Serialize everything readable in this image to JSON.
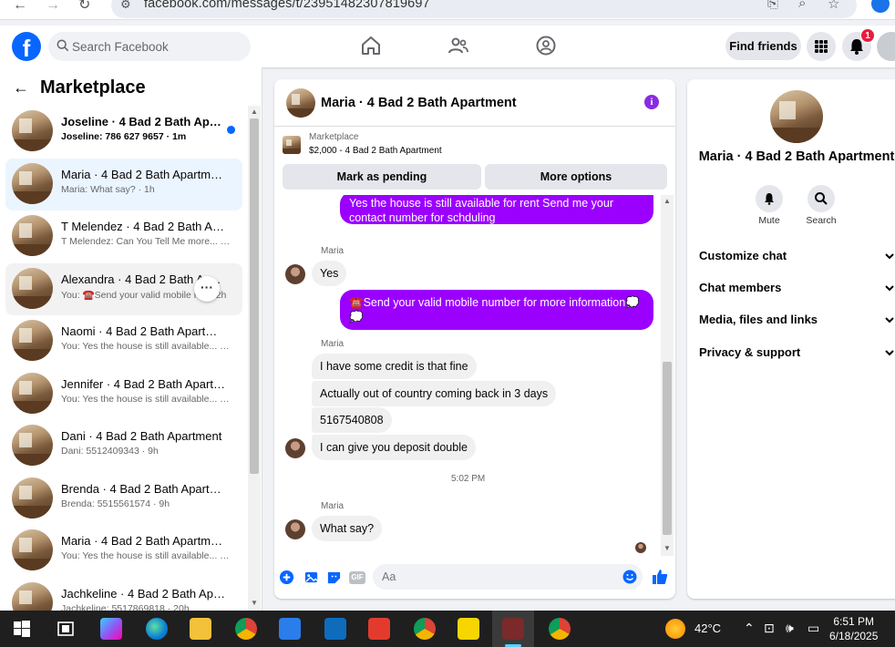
{
  "browser": {
    "url": "facebook.com/messages/t/23951482307819697"
  },
  "header": {
    "search_placeholder": "Search Facebook",
    "find_friends": "Find friends",
    "notification_count": "1"
  },
  "left": {
    "title": "Marketplace",
    "conversations": [
      {
        "name": "Joseline · 4 Bad 2 Bath Apart...",
        "preview": "Joseline: 786 627 9657 · 1m",
        "unread": true
      },
      {
        "name": "Maria · 4 Bad 2 Bath Apartment",
        "preview": "Maria: What say? · 1h",
        "active": true
      },
      {
        "name": "T Melendez · 4 Bad 2 Bath Apar...",
        "preview": "T Melendez: Can You Tell Me more... · 1h"
      },
      {
        "name": "Alexandra · 4 Bad 2 Bath Ap...",
        "preview": "You: ☎️Send your valid mobile n... · 2h",
        "hover": true
      },
      {
        "name": "Naomi · 4 Bad 2 Bath Apartment",
        "preview": "You: Yes the house is still available... · 6h"
      },
      {
        "name": "Jennifer · 4 Bad 2 Bath Apartm...",
        "preview": "You: Yes the house is still available... · 8h"
      },
      {
        "name": "Dani · 4 Bad 2 Bath Apartment",
        "preview": "Dani: 5512409343 · 9h"
      },
      {
        "name": "Brenda · 4 Bad 2 Bath Apartment",
        "preview": "Brenda: 5515561574 · 9h"
      },
      {
        "name": "Maria · 4 Bad 2 Bath Apartment",
        "preview": "You: Yes the house is still available... · 9h"
      },
      {
        "name": "Jachkeline · 4 Bad 2 Bath Apart...",
        "preview": "Jachkeline: 5517869818 · 20h"
      }
    ]
  },
  "chat": {
    "title": "Maria · 4 Bad 2 Bath Apartment",
    "listing_source": "Marketplace",
    "listing_detail": "$2,000 - 4 Bad 2 Bath Apartment",
    "mark_pending": "Mark as pending",
    "more_options": "More options",
    "messages": {
      "out1": "Yes the house is still available for rent Send me your contact number for schduling",
      "sender1": "Maria",
      "in1": "Yes",
      "out2": "☎️Send your valid mobile number for more information💭💭",
      "sender2": "Maria",
      "in2": "I have some credit is that fine",
      "in3": "Actually out of country coming back in 3 days",
      "in4": "5167540808",
      "in5": "I can give you deposit double",
      "time": "5:02 PM",
      "sender3": "Maria",
      "in6": "What say?"
    },
    "input_placeholder": "Aa",
    "gif_label": "GIF"
  },
  "right": {
    "name": "Maria · 4 Bad 2 Bath Apartment",
    "mute": "Mute",
    "search": "Search",
    "sections": [
      "Customize chat",
      "Chat members",
      "Media, files and links",
      "Privacy & support"
    ]
  },
  "taskbar": {
    "temperature": "42°C",
    "time": "6:51 PM",
    "date": "6/18/2025"
  }
}
